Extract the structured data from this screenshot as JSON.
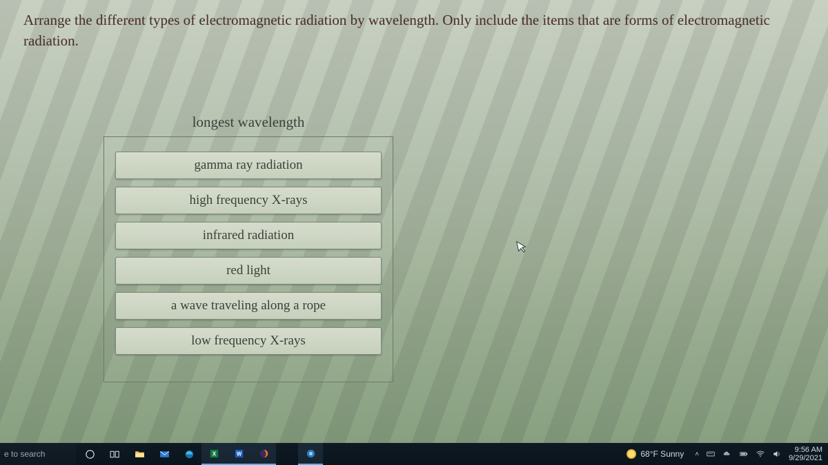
{
  "question": {
    "prompt": "Arrange the different types of electromagnetic radiation by wavelength. Only include the items that are forms of electromagnetic radiation."
  },
  "sort_widget": {
    "top_label": "longest wavelength",
    "items": [
      "gamma ray radiation",
      "high frequency X-rays",
      "infrared radiation",
      "red light",
      "a wave traveling along a rope",
      "low frequency X-rays"
    ]
  },
  "taskbar": {
    "search_placeholder": "e to search",
    "weather": "68°F Sunny",
    "time": "9:56 AM",
    "date": "9/29/2021"
  }
}
